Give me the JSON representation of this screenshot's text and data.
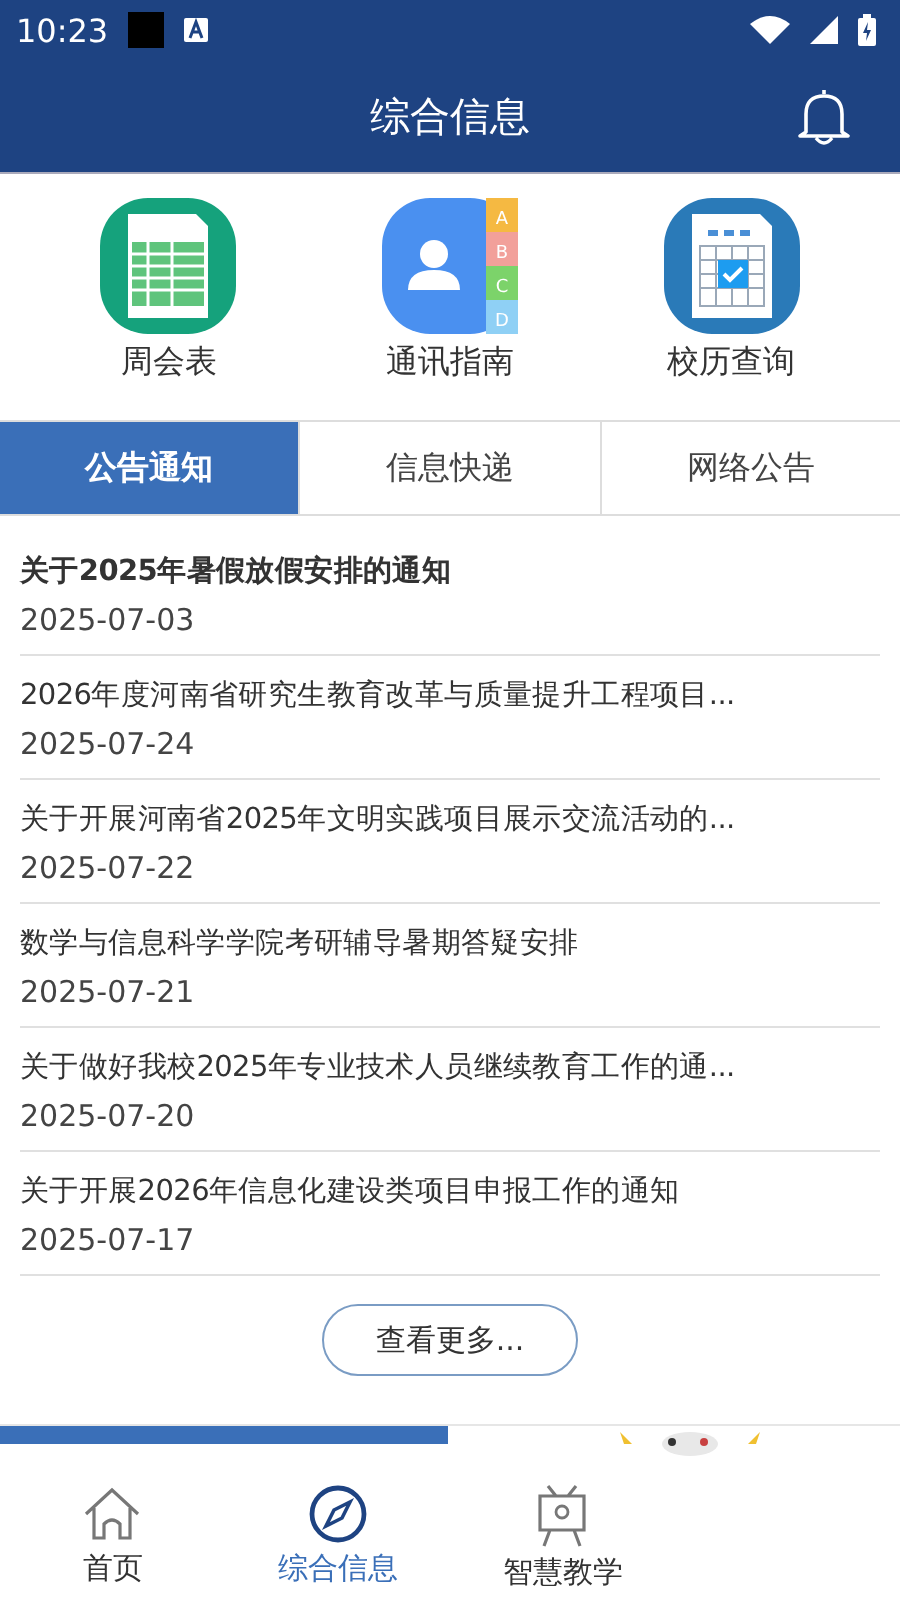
{
  "status_bar": {
    "time": "10:23"
  },
  "header": {
    "title": "综合信息"
  },
  "shortcuts": [
    {
      "kind": "sheet",
      "label": "周会表"
    },
    {
      "kind": "contacts",
      "label": "通讯指南",
      "letters": [
        "A",
        "B",
        "C",
        "D"
      ]
    },
    {
      "kind": "calendar",
      "label": "校历查询"
    }
  ],
  "tabs": [
    {
      "label": "公告通知",
      "selected": true
    },
    {
      "label": "信息快递",
      "selected": false
    },
    {
      "label": "网络公告",
      "selected": false
    }
  ],
  "notices": [
    {
      "title": "关于2025年暑假放假安排的通知",
      "date": "2025-07-03",
      "bold": true
    },
    {
      "title": "2026年度河南省研究生教育改革与质量提升工程项目...",
      "date": "2025-07-24",
      "bold": false
    },
    {
      "title": "关于开展河南省2025年文明实践项目展示交流活动的...",
      "date": "2025-07-22",
      "bold": false
    },
    {
      "title": "数学与信息科学学院考研辅导暑期答疑安排",
      "date": "2025-07-21",
      "bold": false
    },
    {
      "title": "关于做好我校2025年专业技术人员继续教育工作的通...",
      "date": "2025-07-20",
      "bold": false
    },
    {
      "title": "关于开展2026年信息化建设类项目申报工作的通知",
      "date": "2025-07-17",
      "bold": false
    }
  ],
  "more_button": "查看更多...",
  "bottom_nav": [
    {
      "kind": "home",
      "label": "首页",
      "selected": false
    },
    {
      "kind": "compass",
      "label": "综合信息",
      "selected": true
    },
    {
      "kind": "easel",
      "label": "智慧教学",
      "selected": false
    }
  ]
}
